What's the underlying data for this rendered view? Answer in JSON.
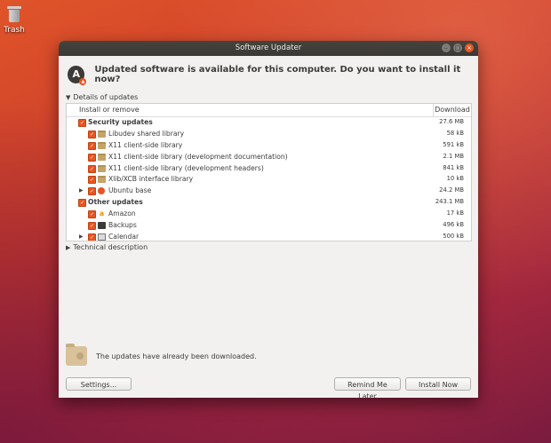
{
  "desktop": {
    "trash_label": "Trash"
  },
  "window": {
    "title": "Software Updater",
    "headline": "Updated software is available for this computer. Do you want to install it now?",
    "app_icon_glyph": "A",
    "details_label": "Details of updates",
    "columns": {
      "name": "Install or remove",
      "download": "Download"
    },
    "rows": [
      {
        "type": "group",
        "name": "Security updates",
        "size": "27.6 MB",
        "checked": true,
        "expander": false,
        "icon": "none",
        "indent": 0
      },
      {
        "type": "item",
        "name": "Libudev shared library",
        "size": "58 kB",
        "checked": true,
        "expander": false,
        "icon": "folder-icon",
        "indent": 1
      },
      {
        "type": "item",
        "name": "X11 client-side library",
        "size": "591 kB",
        "checked": true,
        "expander": false,
        "icon": "folder-icon",
        "indent": 1
      },
      {
        "type": "item",
        "name": "X11 client-side library (development documentation)",
        "size": "2.1 MB",
        "checked": true,
        "expander": false,
        "icon": "folder-icon",
        "indent": 1
      },
      {
        "type": "item",
        "name": "X11 client-side library (development headers)",
        "size": "841 kB",
        "checked": true,
        "expander": false,
        "icon": "folder-icon",
        "indent": 1
      },
      {
        "type": "item",
        "name": "Xlib/XCB interface library",
        "size": "10 kB",
        "checked": true,
        "expander": false,
        "icon": "folder-icon",
        "indent": 1
      },
      {
        "type": "item",
        "name": "Ubuntu base",
        "size": "24.2 MB",
        "checked": true,
        "expander": true,
        "icon": "ubuntu-icon",
        "indent": 1
      },
      {
        "type": "group",
        "name": "Other updates",
        "size": "243.1 MB",
        "checked": true,
        "expander": false,
        "icon": "none",
        "indent": 0
      },
      {
        "type": "item",
        "name": "Amazon",
        "size": "17 kB",
        "checked": true,
        "expander": false,
        "icon": "amazon-icon",
        "indent": 1
      },
      {
        "type": "item",
        "name": "Backups",
        "size": "496 kB",
        "checked": true,
        "expander": false,
        "icon": "backups-icon",
        "indent": 1
      },
      {
        "type": "item",
        "name": "Calendar",
        "size": "500 kB",
        "checked": true,
        "expander": true,
        "icon": "calendar-icon",
        "indent": 1
      }
    ],
    "technical_label": "Technical description",
    "status_text": "The updates have already been downloaded.",
    "buttons": {
      "settings": "Settings...",
      "remind": "Remind Me Later",
      "install": "Install Now"
    },
    "accent_color": "#e95420"
  }
}
